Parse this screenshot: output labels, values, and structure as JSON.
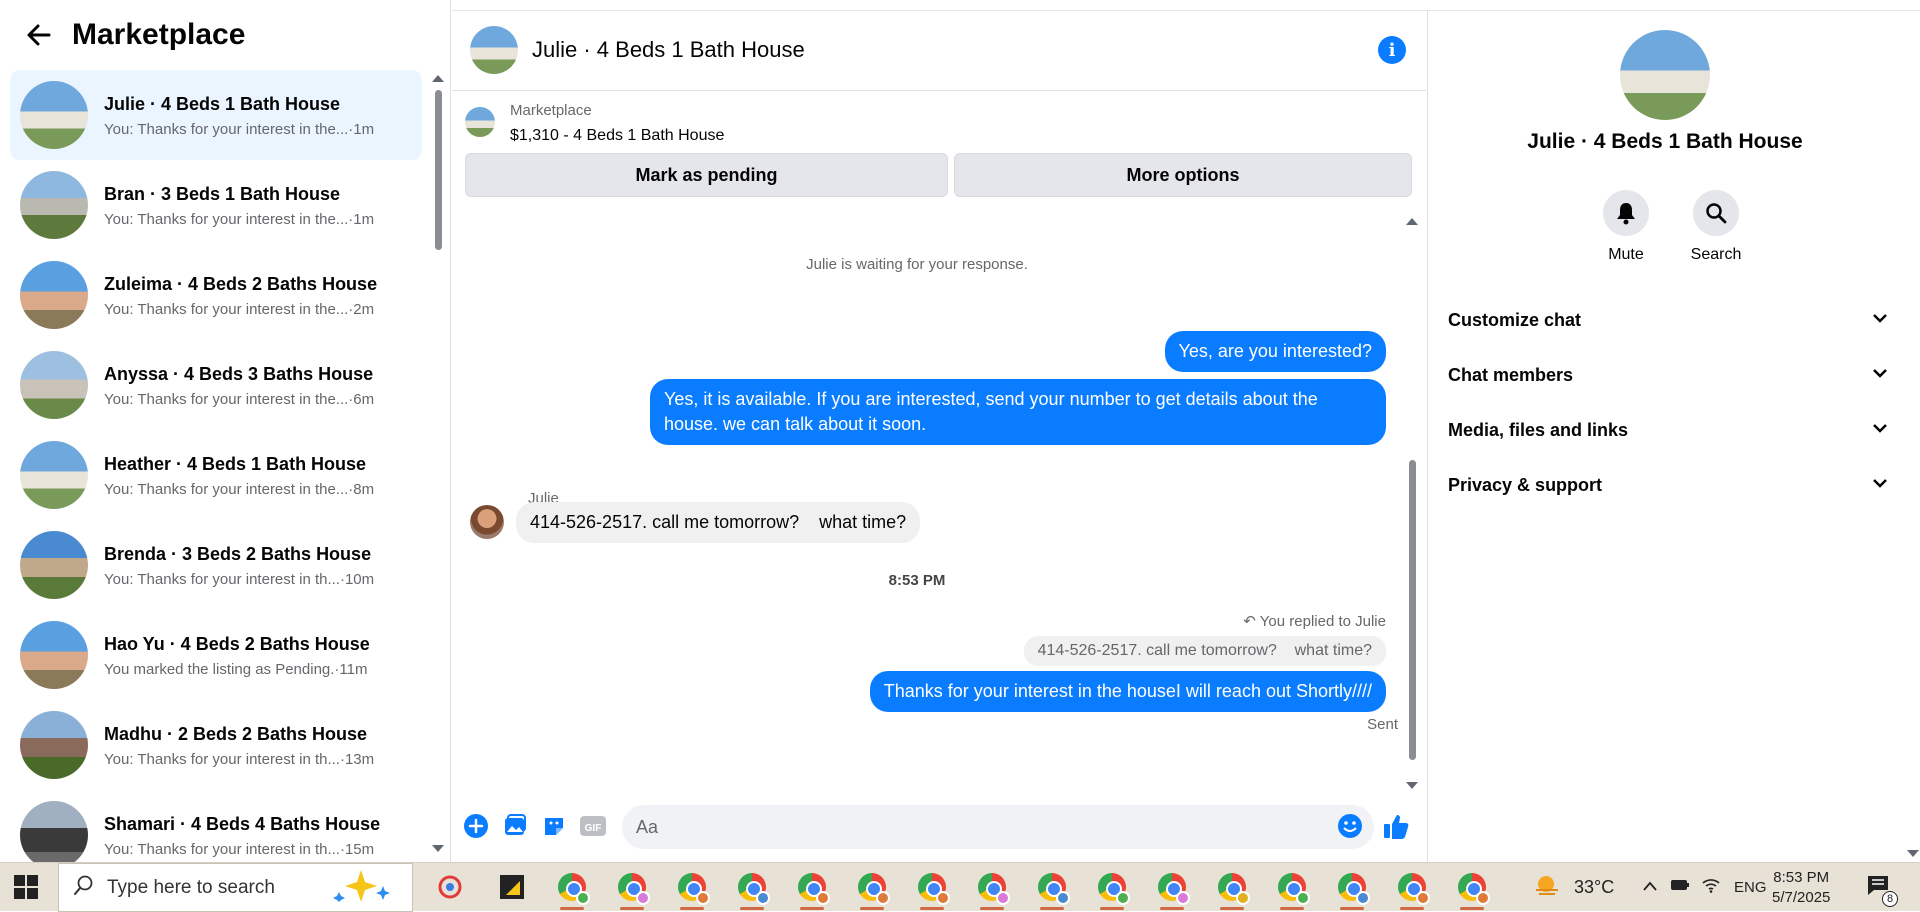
{
  "sidebar": {
    "title": "Marketplace",
    "conversations": [
      {
        "name": "Julie · 4 Beds 1 Bath House",
        "snippet": "You: Thanks for your interest in the...·1m",
        "active": true
      },
      {
        "name": "Bran · 3 Beds 1 Bath House",
        "snippet": "You: Thanks for your interest in the...·1m"
      },
      {
        "name": "Zuleima · 4 Beds 2 Baths House",
        "snippet": "You: Thanks for your interest in the...·2m"
      },
      {
        "name": "Anyssa · 4 Beds 3 Baths House",
        "snippet": "You: Thanks for your interest in the...·6m"
      },
      {
        "name": "Heather · 4 Beds 1 Bath House",
        "snippet": "You: Thanks for your interest in the...·8m"
      },
      {
        "name": "Brenda · 3 Beds 2 Baths House",
        "snippet": "You: Thanks for your interest in th...·10m"
      },
      {
        "name": "Hao Yu · 4 Beds 2 Baths House",
        "snippet": "You marked the listing as Pending.·11m"
      },
      {
        "name": "Madhu · 2 Beds 2 Baths House",
        "snippet": "You: Thanks for your interest in th...·13m"
      },
      {
        "name": "Shamari · 4 Beds 4 Baths House",
        "snippet": "You: Thanks for your interest in th...·15m"
      }
    ]
  },
  "chat": {
    "title": "Julie · 4 Beds 1 Bath House",
    "listing_label": "Marketplace",
    "listing_price": "$1,310 - 4 Beds 1 Bath House",
    "mark_pending": "Mark as pending",
    "more_options": "More options",
    "waiting": "Julie is waiting for your response.",
    "out_msg_1": "Yes, are you interested?",
    "out_msg_2a": "Yes, it is available. If you are interested, send your number to get details about the",
    "out_msg_2b": "house. we can talk about it soon.",
    "sender": "Julie",
    "in_msg": "414-526-2517. call me tomorrow?    what time?",
    "time": "8:53 PM",
    "replied": "You replied to Julie",
    "quoted": "414-526-2517. call me tomorrow?    what time?",
    "out_msg_3": "Thanks for your interest in the houseI will reach out Shortly////",
    "sent": "Sent",
    "input_placeholder": "Aa"
  },
  "details": {
    "name": "Julie · 4 Beds 1 Bath House",
    "mute": "Mute",
    "search": "Search",
    "sections": [
      "Customize chat",
      "Chat members",
      "Media, files and links",
      "Privacy & support"
    ]
  },
  "taskbar": {
    "search_placeholder": "Type here to search",
    "temperature": "33°C",
    "language": "ENG",
    "time": "8:53 PM",
    "date": "5/7/2025",
    "notifications": "8"
  },
  "colors": {
    "accent": "#0a7cff",
    "active_bg": "#ebf5ff"
  }
}
